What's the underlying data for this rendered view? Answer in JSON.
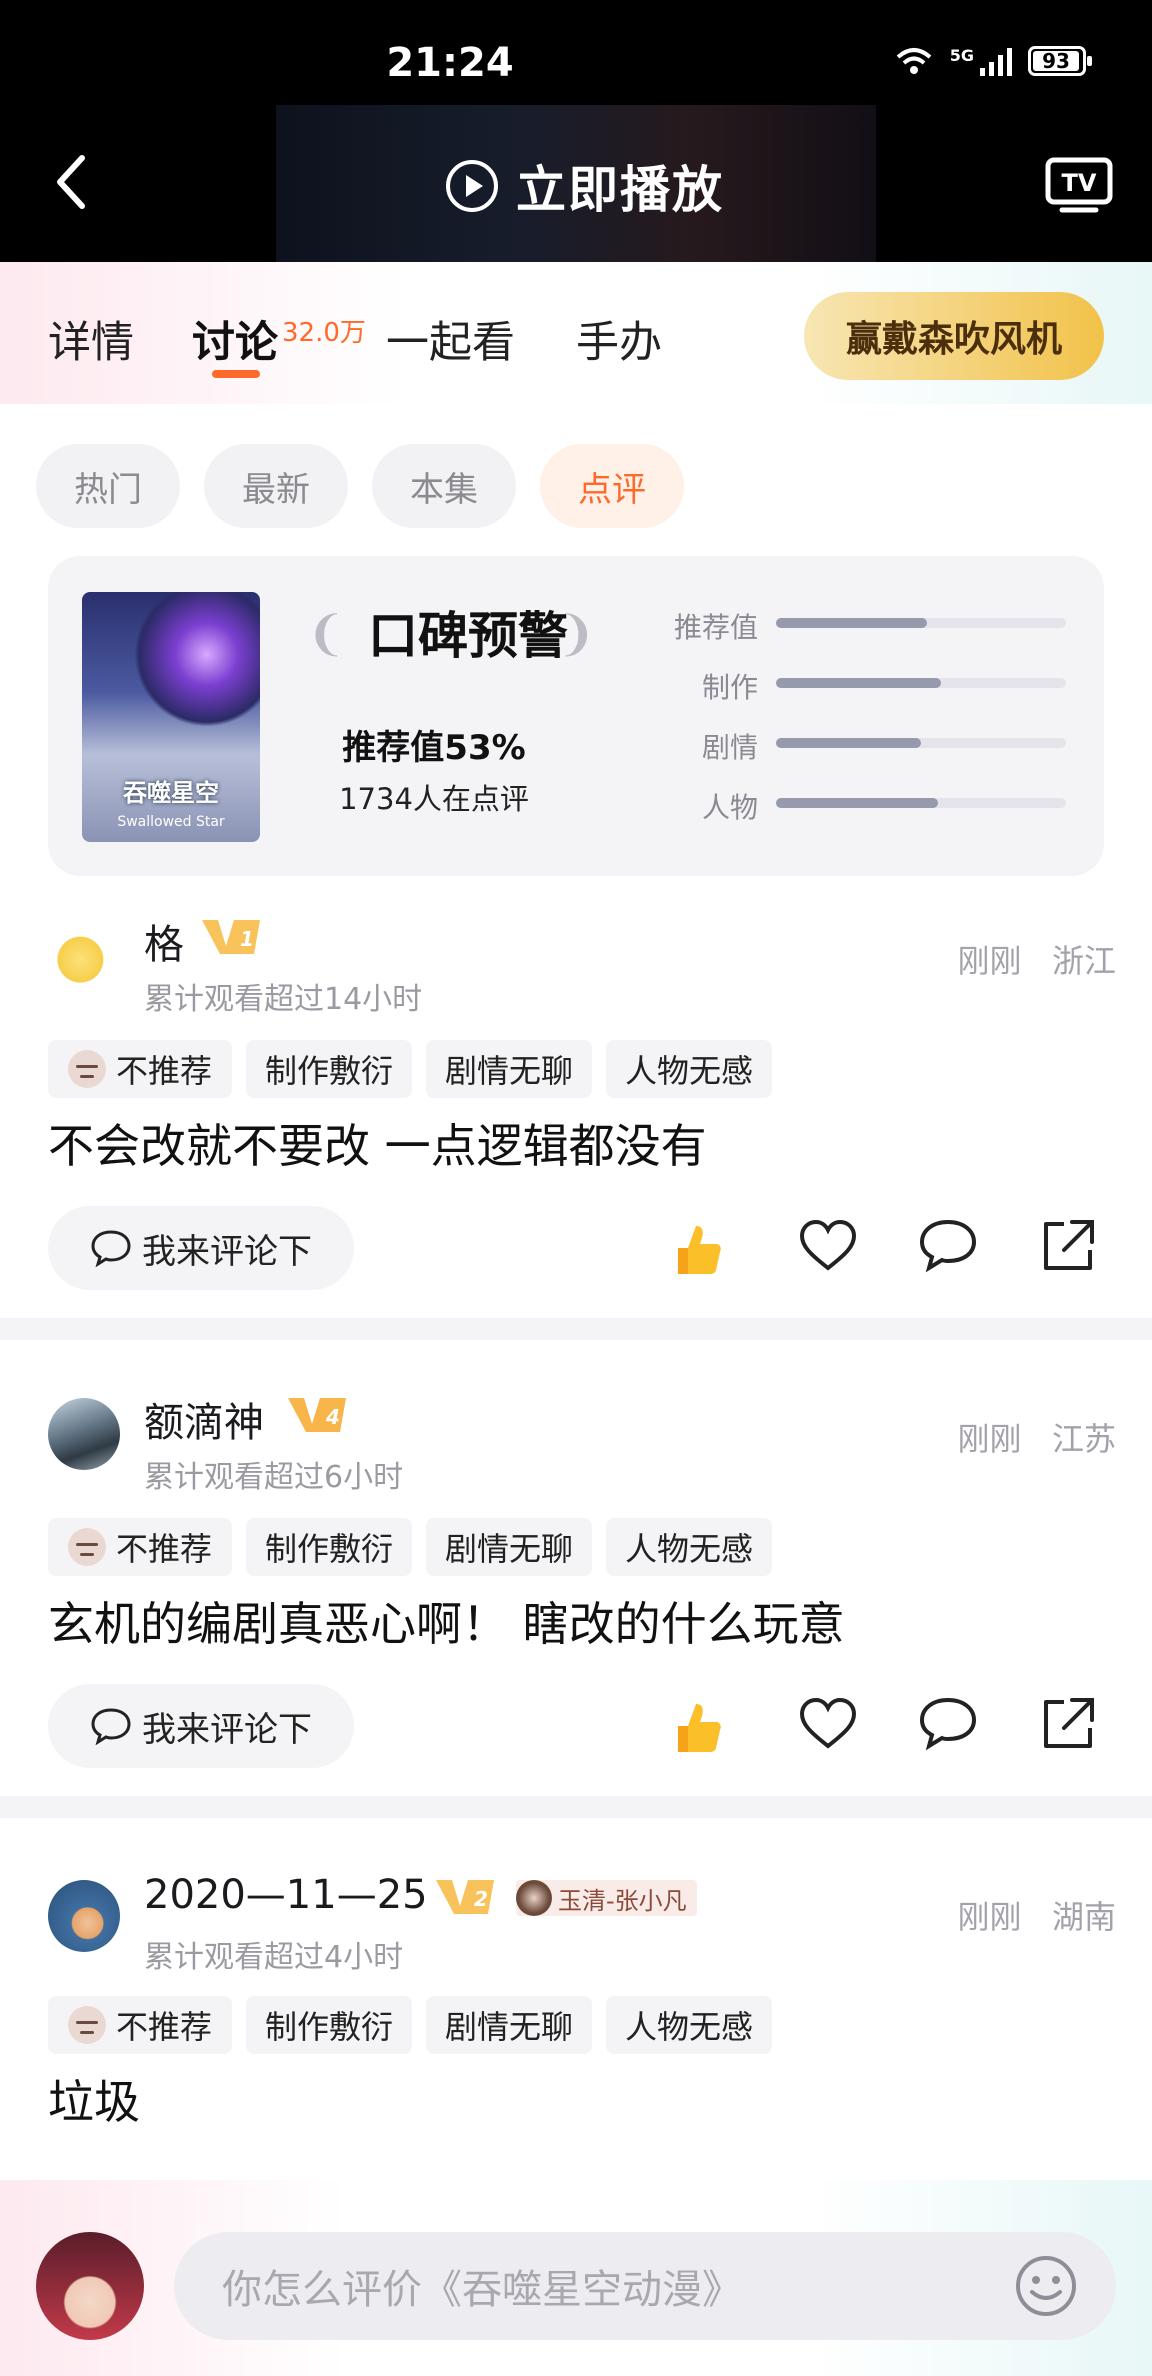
{
  "status_bar": {
    "time": "21:24",
    "network": "5G",
    "battery": "93"
  },
  "player": {
    "play_label": "立即播放"
  },
  "tabs": [
    {
      "label": "详情",
      "active": false
    },
    {
      "label": "讨论",
      "active": true,
      "count": "32.0万"
    },
    {
      "label": "一起看",
      "active": false
    },
    {
      "label": "手办",
      "active": false
    }
  ],
  "promo": {
    "label": "赢戴森吹风机"
  },
  "filters": [
    {
      "label": "热门",
      "active": false
    },
    {
      "label": "最新",
      "active": false
    },
    {
      "label": "本集",
      "active": false
    },
    {
      "label": "点评",
      "active": true
    }
  ],
  "rating": {
    "poster_title": "吞噬星空",
    "poster_subtitle": "Swallowed Star",
    "warning_title": "口碑预警",
    "recommend_pct": "推荐值53%",
    "reviewers": "1734人在点评",
    "metrics": [
      {
        "label": "推荐值",
        "value": 0.52
      },
      {
        "label": "制作",
        "value": 0.57
      },
      {
        "label": "剧情",
        "value": 0.5
      },
      {
        "label": "人物",
        "value": 0.56
      }
    ]
  },
  "comments": [
    {
      "username": "格",
      "level": "1",
      "watch_time": "累计观看超过14小时",
      "time": "刚刚",
      "location": "浙江",
      "tags": [
        "不推荐",
        "制作敷衍",
        "剧情无聊",
        "人物无感"
      ],
      "text": "不会改就不要改 一点逻辑都没有",
      "reply_label": "我来评论下"
    },
    {
      "username": "额滴神",
      "level": "4",
      "watch_time": "累计观看超过6小时",
      "time": "刚刚",
      "location": "江苏",
      "tags": [
        "不推荐",
        "制作敷衍",
        "剧情无聊",
        "人物无感"
      ],
      "text": "玄机的编剧真恶心啊！ 瞎改的什么玩意",
      "reply_label": "我来评论下"
    },
    {
      "username": "2020—11—25",
      "level": "2",
      "fan_tag": "玉清-张小凡",
      "watch_time": "累计观看超过4小时",
      "time": "刚刚",
      "location": "湖南",
      "tags": [
        "不推荐",
        "制作敷衍",
        "剧情无聊",
        "人物无感"
      ],
      "text": "垃圾"
    }
  ],
  "input": {
    "placeholder": "你怎么评价《吞噬星空动漫》"
  },
  "colors": {
    "accent": "#ff6a2b",
    "promo_start": "#f7e6b4",
    "promo_end": "#f2c24a",
    "bar": "#9799ad"
  }
}
